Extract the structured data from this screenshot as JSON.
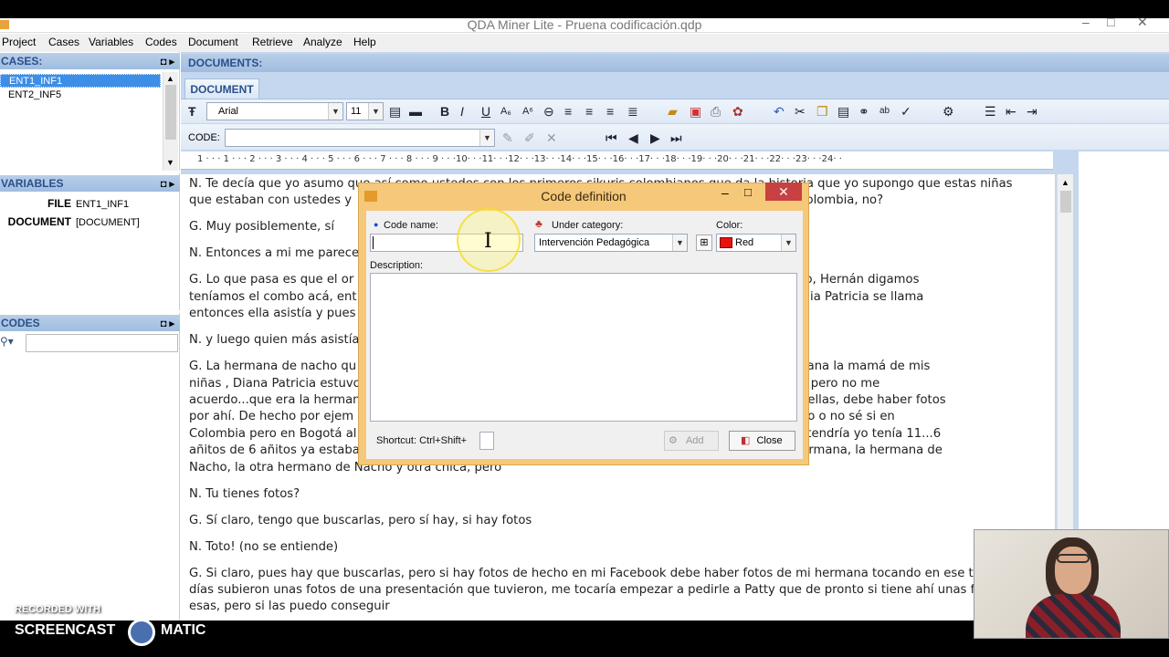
{
  "window": {
    "title": "QDA Miner Lite - Pruena codificación.qdp"
  },
  "menu": [
    "Project",
    "Cases",
    "Variables",
    "Codes",
    "Document",
    "Retrieve",
    "Analyze",
    "Help"
  ],
  "cases": {
    "header": "CASES:",
    "items": [
      "ENT1_INF1",
      "ENT2_INF5"
    ],
    "selected": "ENT1_INF1"
  },
  "variables": {
    "header": "VARIABLES",
    "rows": [
      {
        "name": "FILE",
        "value": "ENT1_INF1"
      },
      {
        "name": "DOCUMENT",
        "value": "[DOCUMENT]"
      }
    ]
  },
  "codes": {
    "header": "CODES"
  },
  "documents": {
    "header": "DOCUMENTS:",
    "tab": "DOCUMENT"
  },
  "toolbar": {
    "font": "Arial",
    "size": "11",
    "code_label": "CODE:"
  },
  "ruler": "1 · · · 1 · · · 2 · · · 3 · · · 4 · · · 5 · · · 6 · · · 7 · · · 8 · · · 9 · · ·10· · ·11· · ·12· · ·13· · ·14· · ·15· · ·16· · ·17· · ·18· · ·19· · ·20· · ·21· · ·22· · ·23· · ·24· ·",
  "document_lines": [
    "N. Te decía que yo asumo que así como ustedes con los primeros sikuris colombianos que da la historia que yo supongo que estas niñas",
    "que estaban con ustedes y                                                                                               la historia de Colombia, no?",
    "G. Muy posiblemente, sí",
    "N. Entonces a mi me parece",
    "G. Lo que pasa es que el or                                                                                             r ejemplo, Nacho, Hernán digamos",
    "teníamos el combo acá, ent                                                                                              cho Patty...  Nidia Patricia se llama",
    "entonces ella asistía y pues                                                                                            na de Nacho ...",
    "N. y luego quien más asistía",
    "G. La hermana de nacho qu                                                                                               o muy poco Diana la mamá de mis",
    "niñas , Diana Patricia estuvo                                                                                           había otra china pero no me",
    "acuerdo...que era la herman                                                                                             tra chica, eran ellas, debe haber fotos",
    "por ahí. De hecho por ejem                                                                                              r sikuri femenino o no sé si en",
    "Colombia pero en Bogotá al                                                                                              nces claro ella tendría yo tenía 11...6",
    "añitos de 6 añitos ya estaba                                                                                            onces era mi hermana, la hermana de",
    "Nacho, la otra hermano de Nacho y otra chica, pero",
    "N. Tu tienes fotos?",
    "G. Sí claro, tengo que buscarlas, pero sí hay, si hay fotos",
    "N. Toto! (no se entiende)",
    "G. Si claro, pues hay que buscarlas, pero si hay fotos de hecho en mi Facebook debe haber fotos de mi hermana tocando en ese ti",
    "días subieron unas fotos de una presentación que tuvieron, me tocaría empezar a pedirle a Patty que de pronto si tiene ahí unas fo",
    "esas, pero si las puedo conseguir"
  ],
  "dialog": {
    "title": "Code definition",
    "code_name_label": "Code name:",
    "code_name_value": "",
    "category_label": "Under category:",
    "category_value": "Intervención Pedagógica",
    "color_label": "Color:",
    "color_value": "Red",
    "color_swatch": "#e8150f",
    "description_label": "Description:",
    "shortcut_label": "Shortcut: Ctrl+Shift+",
    "add_label": "Add",
    "close_label": "Close"
  },
  "watermark": {
    "line1": "RECORDED WITH",
    "line2": "SCREENCAST",
    "line3": "MATIC"
  }
}
